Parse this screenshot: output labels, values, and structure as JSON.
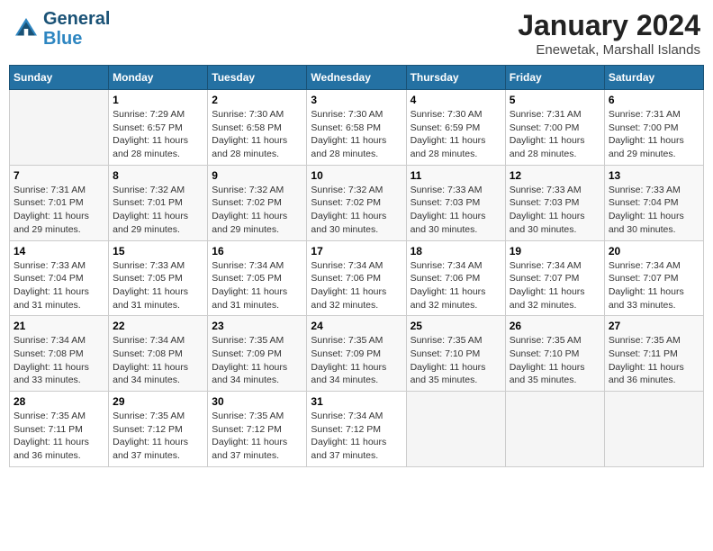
{
  "header": {
    "logo_line1": "General",
    "logo_line2": "Blue",
    "title": "January 2024",
    "subtitle": "Enewetak, Marshall Islands"
  },
  "days_of_week": [
    "Sunday",
    "Monday",
    "Tuesday",
    "Wednesday",
    "Thursday",
    "Friday",
    "Saturday"
  ],
  "weeks": [
    [
      {
        "day": "",
        "info": ""
      },
      {
        "day": "1",
        "info": "Sunrise: 7:29 AM\nSunset: 6:57 PM\nDaylight: 11 hours\nand 28 minutes."
      },
      {
        "day": "2",
        "info": "Sunrise: 7:30 AM\nSunset: 6:58 PM\nDaylight: 11 hours\nand 28 minutes."
      },
      {
        "day": "3",
        "info": "Sunrise: 7:30 AM\nSunset: 6:58 PM\nDaylight: 11 hours\nand 28 minutes."
      },
      {
        "day": "4",
        "info": "Sunrise: 7:30 AM\nSunset: 6:59 PM\nDaylight: 11 hours\nand 28 minutes."
      },
      {
        "day": "5",
        "info": "Sunrise: 7:31 AM\nSunset: 7:00 PM\nDaylight: 11 hours\nand 28 minutes."
      },
      {
        "day": "6",
        "info": "Sunrise: 7:31 AM\nSunset: 7:00 PM\nDaylight: 11 hours\nand 29 minutes."
      }
    ],
    [
      {
        "day": "7",
        "info": "Sunrise: 7:31 AM\nSunset: 7:01 PM\nDaylight: 11 hours\nand 29 minutes."
      },
      {
        "day": "8",
        "info": "Sunrise: 7:32 AM\nSunset: 7:01 PM\nDaylight: 11 hours\nand 29 minutes."
      },
      {
        "day": "9",
        "info": "Sunrise: 7:32 AM\nSunset: 7:02 PM\nDaylight: 11 hours\nand 29 minutes."
      },
      {
        "day": "10",
        "info": "Sunrise: 7:32 AM\nSunset: 7:02 PM\nDaylight: 11 hours\nand 30 minutes."
      },
      {
        "day": "11",
        "info": "Sunrise: 7:33 AM\nSunset: 7:03 PM\nDaylight: 11 hours\nand 30 minutes."
      },
      {
        "day": "12",
        "info": "Sunrise: 7:33 AM\nSunset: 7:03 PM\nDaylight: 11 hours\nand 30 minutes."
      },
      {
        "day": "13",
        "info": "Sunrise: 7:33 AM\nSunset: 7:04 PM\nDaylight: 11 hours\nand 30 minutes."
      }
    ],
    [
      {
        "day": "14",
        "info": "Sunrise: 7:33 AM\nSunset: 7:04 PM\nDaylight: 11 hours\nand 31 minutes."
      },
      {
        "day": "15",
        "info": "Sunrise: 7:33 AM\nSunset: 7:05 PM\nDaylight: 11 hours\nand 31 minutes."
      },
      {
        "day": "16",
        "info": "Sunrise: 7:34 AM\nSunset: 7:05 PM\nDaylight: 11 hours\nand 31 minutes."
      },
      {
        "day": "17",
        "info": "Sunrise: 7:34 AM\nSunset: 7:06 PM\nDaylight: 11 hours\nand 32 minutes."
      },
      {
        "day": "18",
        "info": "Sunrise: 7:34 AM\nSunset: 7:06 PM\nDaylight: 11 hours\nand 32 minutes."
      },
      {
        "day": "19",
        "info": "Sunrise: 7:34 AM\nSunset: 7:07 PM\nDaylight: 11 hours\nand 32 minutes."
      },
      {
        "day": "20",
        "info": "Sunrise: 7:34 AM\nSunset: 7:07 PM\nDaylight: 11 hours\nand 33 minutes."
      }
    ],
    [
      {
        "day": "21",
        "info": "Sunrise: 7:34 AM\nSunset: 7:08 PM\nDaylight: 11 hours\nand 33 minutes."
      },
      {
        "day": "22",
        "info": "Sunrise: 7:34 AM\nSunset: 7:08 PM\nDaylight: 11 hours\nand 34 minutes."
      },
      {
        "day": "23",
        "info": "Sunrise: 7:35 AM\nSunset: 7:09 PM\nDaylight: 11 hours\nand 34 minutes."
      },
      {
        "day": "24",
        "info": "Sunrise: 7:35 AM\nSunset: 7:09 PM\nDaylight: 11 hours\nand 34 minutes."
      },
      {
        "day": "25",
        "info": "Sunrise: 7:35 AM\nSunset: 7:10 PM\nDaylight: 11 hours\nand 35 minutes."
      },
      {
        "day": "26",
        "info": "Sunrise: 7:35 AM\nSunset: 7:10 PM\nDaylight: 11 hours\nand 35 minutes."
      },
      {
        "day": "27",
        "info": "Sunrise: 7:35 AM\nSunset: 7:11 PM\nDaylight: 11 hours\nand 36 minutes."
      }
    ],
    [
      {
        "day": "28",
        "info": "Sunrise: 7:35 AM\nSunset: 7:11 PM\nDaylight: 11 hours\nand 36 minutes."
      },
      {
        "day": "29",
        "info": "Sunrise: 7:35 AM\nSunset: 7:12 PM\nDaylight: 11 hours\nand 37 minutes."
      },
      {
        "day": "30",
        "info": "Sunrise: 7:35 AM\nSunset: 7:12 PM\nDaylight: 11 hours\nand 37 minutes."
      },
      {
        "day": "31",
        "info": "Sunrise: 7:34 AM\nSunset: 7:12 PM\nDaylight: 11 hours\nand 37 minutes."
      },
      {
        "day": "",
        "info": ""
      },
      {
        "day": "",
        "info": ""
      },
      {
        "day": "",
        "info": ""
      }
    ]
  ]
}
